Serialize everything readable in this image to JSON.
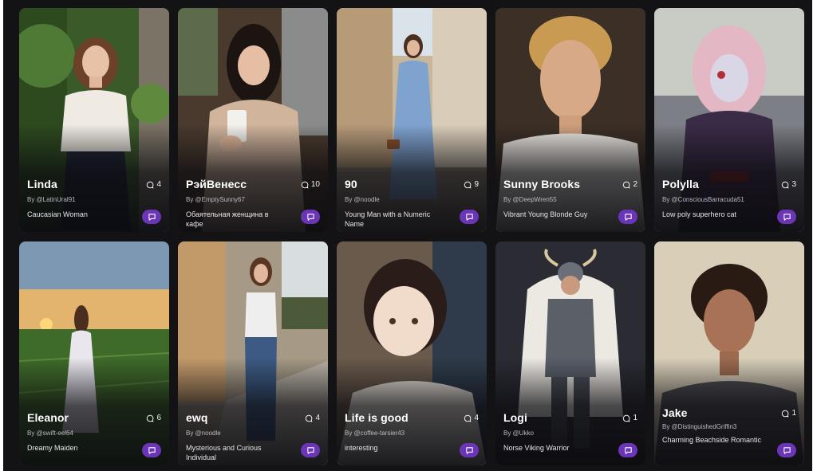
{
  "cards": [
    {
      "name": "Linda",
      "author": "By @LatinUral91",
      "description": "Caucasian Woman",
      "count": "4",
      "icon": "comment-icon"
    },
    {
      "name": "РэйВенесс",
      "author": "By @EmptySunny67",
      "description": "Обаятельная женщина в кафе",
      "count": "10",
      "icon": "comment-icon"
    },
    {
      "name": "90",
      "author": "By @noodle",
      "description": "Young Man with a Numeric Name",
      "count": "9",
      "icon": "comment-icon"
    },
    {
      "name": "Sunny Brooks",
      "author": "By @DeepWren55",
      "description": "Vibrant Young Blonde Guy",
      "count": "2",
      "icon": "comment-icon"
    },
    {
      "name": "Polylla",
      "author": "By @ConsciousBarracuda51",
      "description": "Low poly superhero cat",
      "count": "3",
      "icon": "comment-icon"
    },
    {
      "name": "Eleanor",
      "author": "By @swift-eel64",
      "description": "Dreamy Maiden",
      "count": "6",
      "icon": "comment-icon"
    },
    {
      "name": "ewq",
      "author": "By @noodle",
      "description": "Mysterious and Curious Individual",
      "count": "4",
      "icon": "comment-icon"
    },
    {
      "name": "Life is good",
      "author": "By @coffee-tarsier43",
      "description": "interesting",
      "count": "4",
      "icon": "comment-icon"
    },
    {
      "name": "Logi",
      "author": "By @Ukko",
      "description": "Norse Viking Warrior",
      "count": "1",
      "icon": "comment-icon"
    },
    {
      "name": "Jake",
      "author": "By @DistinguishedGriffin3",
      "description": "Charming Beachside Romantic",
      "count": "1",
      "icon": "comment-icon"
    }
  ],
  "colors": {
    "background": "#131316",
    "chat_button": "#6b35b8"
  }
}
